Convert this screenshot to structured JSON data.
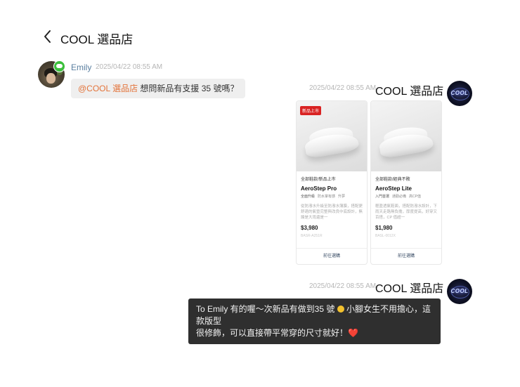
{
  "header": {
    "title": "COOL 選品店"
  },
  "incoming": {
    "sender": "Emily",
    "timestamp": "2025/04/22 08:55 AM",
    "mention": "@COOL 選品店",
    "text": " 想問新品有支援 35 號嗎？"
  },
  "outgoing_products": {
    "timestamp": "2025/04/22 08:55 AM",
    "sender": "COOL 選品店",
    "avatar_text": "COOL",
    "cards": [
      {
        "tag": "新品上市",
        "category": "全部鞋款/新品上市",
        "name": "AeroStep Pro",
        "chips": [
          "全面升級",
          "防水掌有感",
          "升夢"
        ],
        "desc": "從防潑水升級至防潑水薄膜，搭配更舒適的氣墊完整與改良中底設計，無論是大雨還是一",
        "price": "$3,980",
        "sku": "BASR-A251R",
        "button": "前往選購"
      },
      {
        "tag": "",
        "category": "全部鞋款/經典不敗",
        "name": "AeroStep Lite",
        "chips": [
          "入門首選",
          "通勤必備",
          "高CP值"
        ],
        "desc": "輕盈透氣鞋面，搭配防潑水設計，下雨天走路無負擔，厚度提高，好穿又百搭，CP 值超一",
        "price": "$1,980",
        "sku": "BASL-0012X",
        "button": "前往選購"
      }
    ]
  },
  "outgoing_text": {
    "timestamp": "2025/04/22 08:55 AM",
    "sender": "COOL 選品店",
    "avatar_text": "COOL",
    "line1": "To Emily 有的喔～次新品有做到35 號",
    "line1b": " 小腳女生不用擔心，這款版型",
    "line2": "很修飾，可以直接帶平常穿的尺寸就好！",
    "heart": "❤️"
  },
  "colors": {
    "mention": "#e3733a",
    "bubble_out": "#2f2f2f",
    "sale_tag": "#d92323"
  }
}
